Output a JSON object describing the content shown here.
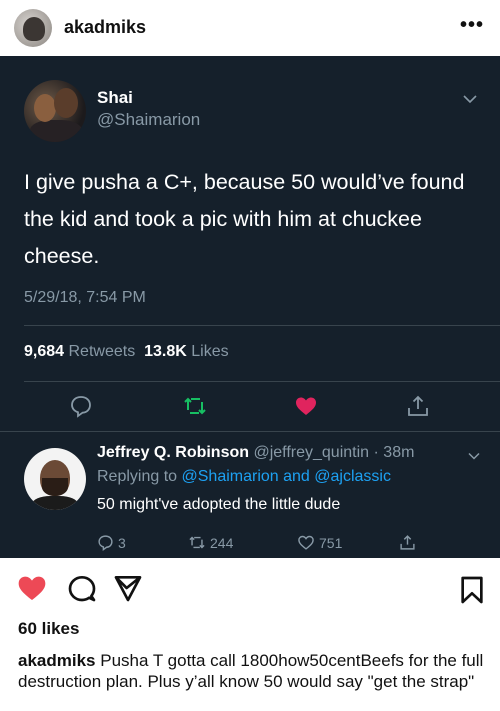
{
  "instagram": {
    "username": "akadmiks",
    "more_label": "•••",
    "likes": "60 likes",
    "caption_user": "akadmiks",
    "caption_text": "Pusha T gotta call 1800how50centBeefs for the full destruction plan. Plus y’all know 50 would say \"get the strap\""
  },
  "tweet": {
    "author_name": "Shai",
    "author_handle": "@Shaimarion",
    "text": "I give pusha a C+, because 50 would’ve found the kid and took a pic with him at chuckee cheese.",
    "timestamp": "5/29/18, 7:54 PM",
    "retweets_count": "9,684",
    "retweets_label": "Retweets",
    "likes_count": "13.8K",
    "likes_label": "Likes"
  },
  "reply": {
    "author_name": "Jeffrey Q. Robinson",
    "author_handle": "@jeffrey_quintin",
    "time": "· 38m",
    "replying_prefix": "Replying to",
    "replying_to_1": "@Shaimarion",
    "replying_and": "and",
    "replying_to_2": "@ajclassic",
    "text": "50 might've adopted the little dude",
    "reply_count": "3",
    "retweet_count": "244",
    "like_count": "751"
  },
  "colors": {
    "tweet_bg": "#15202b",
    "secondary_text": "#8899a6",
    "link_blue": "#1da1f2",
    "retweet_green": "#17bf63",
    "heart_red": "#e0245e",
    "ig_heart_red": "#ed4956"
  },
  "icons": {
    "tweet_actions": [
      "reply-icon",
      "retweet-icon",
      "heart-icon",
      "share-icon"
    ],
    "ig_actions": [
      "heart-filled-icon",
      "comment-icon",
      "send-icon",
      "bookmark-icon"
    ]
  }
}
